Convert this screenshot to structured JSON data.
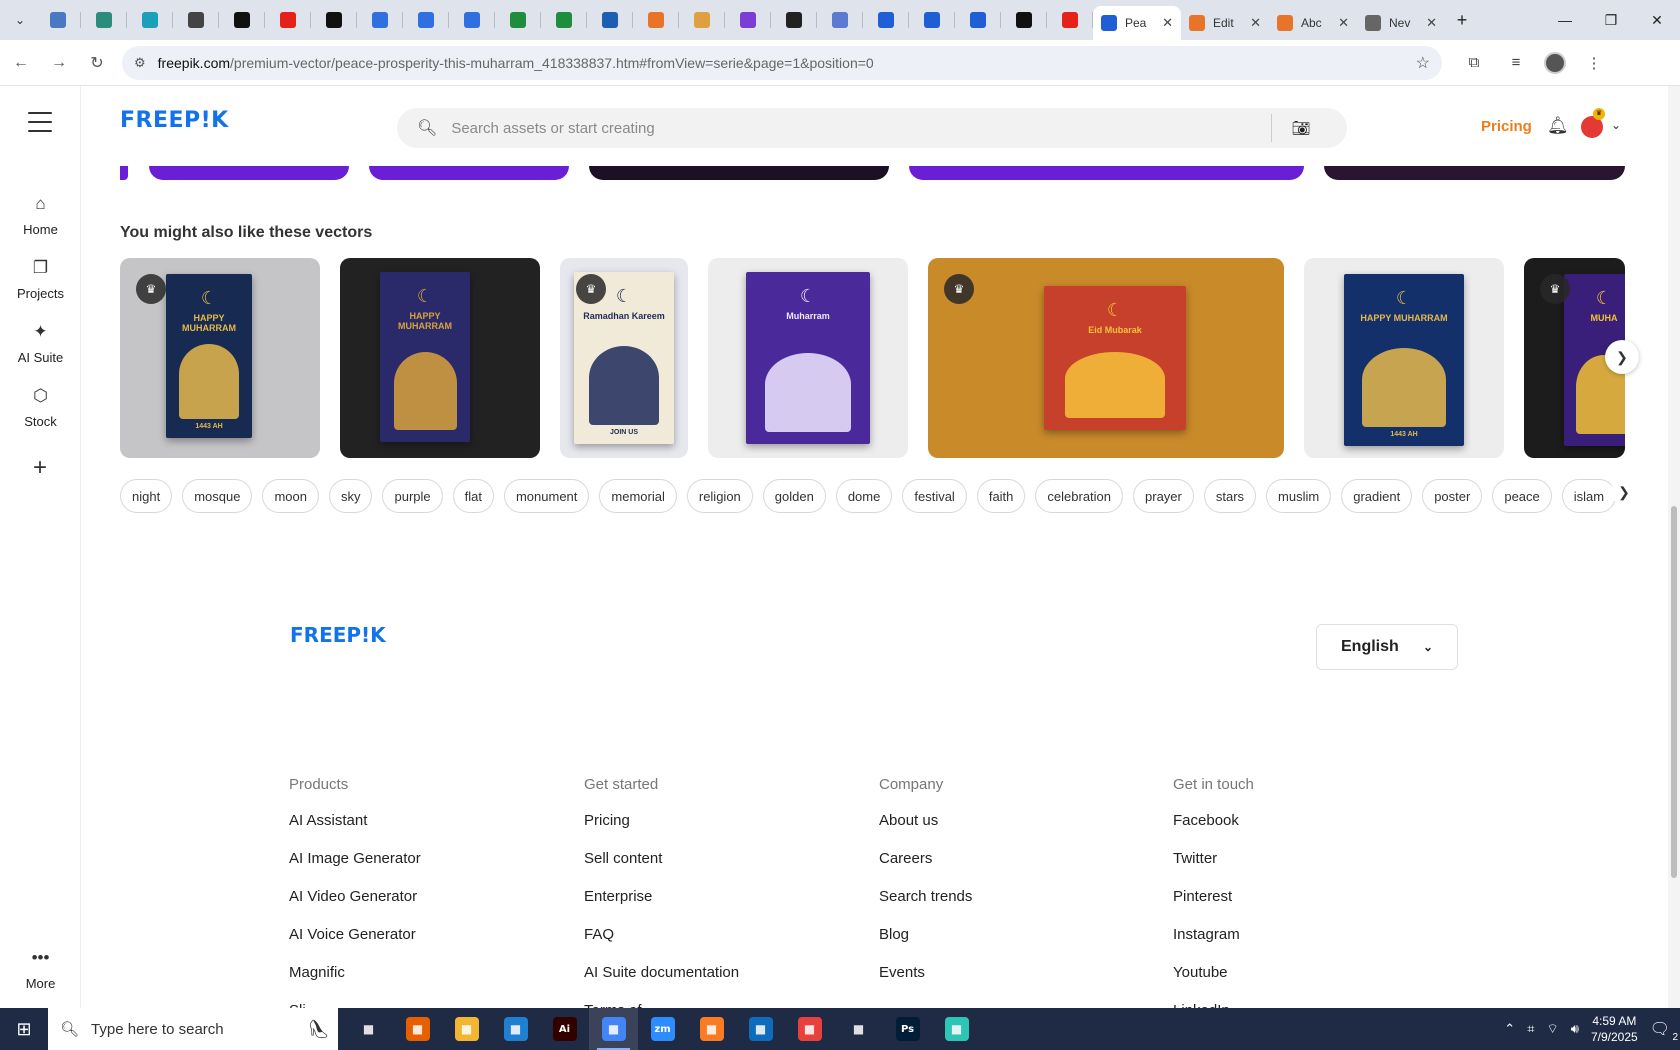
{
  "browser": {
    "pinned_tabs": [
      {
        "icon": "globe-icon",
        "color": "#4a78c2"
      },
      {
        "icon": "vpn-icon",
        "color": "#2a8c7a"
      },
      {
        "icon": "arrow-app-icon",
        "color": "#1aa0b8"
      },
      {
        "icon": "speaker-icon",
        "color": "#444444"
      },
      {
        "icon": "threads-icon",
        "color": "#111111"
      },
      {
        "icon": "youtube-icon",
        "color": "#e62117"
      },
      {
        "icon": "bolt-icon",
        "color": "#111111"
      },
      {
        "icon": "docs-icon",
        "color": "#2f6fe0"
      },
      {
        "icon": "docs-icon",
        "color": "#2f6fe0"
      },
      {
        "icon": "docs-icon",
        "color": "#2f6fe0"
      },
      {
        "icon": "sheets-icon",
        "color": "#1e8e3e"
      },
      {
        "icon": "sheets-icon",
        "color": "#1e8e3e"
      },
      {
        "icon": "word-icon",
        "color": "#1a5fb4"
      },
      {
        "icon": "tool-icon",
        "color": "#e8742a"
      },
      {
        "icon": "star-app-icon",
        "color": "#e0a040"
      },
      {
        "icon": "code-icon",
        "color": "#7a3dd6"
      },
      {
        "icon": "ai-icon",
        "color": "#222222"
      },
      {
        "icon": "grid-icon",
        "color": "#5a7bd0"
      },
      {
        "icon": "freepik-icon",
        "color": "#1f5fd6"
      },
      {
        "icon": "freepik-icon",
        "color": "#1f5fd6"
      },
      {
        "icon": "freepik-icon",
        "color": "#1f5fd6"
      },
      {
        "icon": "m-icon",
        "color": "#111111"
      },
      {
        "icon": "youtube-icon",
        "color": "#e62117"
      }
    ],
    "tabs": [
      {
        "title": "Pea",
        "active": true,
        "icon": "freepik-icon",
        "color": "#1f5fd6"
      },
      {
        "title": "Edit",
        "active": false,
        "icon": "tool-icon",
        "color": "#e8742a"
      },
      {
        "title": "Abc",
        "active": false,
        "icon": "tool-icon",
        "color": "#e8742a"
      },
      {
        "title": "Nev",
        "active": false,
        "icon": "chrome-icon",
        "color": "#666666"
      }
    ],
    "url_host": "freepik.com",
    "url_path": "/premium-vector/peace-prosperity-this-muharram_418338837.htm#fromView=serie&page=1&position=0"
  },
  "leftnav": {
    "items": [
      {
        "label": "Home",
        "icon": "home-icon"
      },
      {
        "label": "Projects",
        "icon": "projects-icon"
      },
      {
        "label": "AI Suite",
        "icon": "sparkle-icon"
      },
      {
        "label": "Stock",
        "icon": "stock-icon"
      }
    ],
    "more_label": "More"
  },
  "header": {
    "logo": "FREEP!K",
    "search_placeholder": "Search assets or start creating",
    "pricing": "Pricing"
  },
  "section": {
    "title": "You might also like these vectors",
    "cards": [
      {
        "bg": "#c5c5c8",
        "poster_bg": "#172a52",
        "accent": "#e5b84b",
        "text": "HAPPY MUHARRAM",
        "sub": "1443 AH",
        "premium": true
      },
      {
        "bg": "#222222",
        "poster_bg": "#2a2a6a",
        "accent": "#d9a23a",
        "text": "HAPPY MUHARRAM",
        "sub": "",
        "premium": false
      },
      {
        "bg": "#e6e8ee",
        "poster_bg": "#f2ead8",
        "accent": "#1d2a5a",
        "text": "Ramadhan Kareem",
        "sub": "JOIN US",
        "premium": true
      },
      {
        "bg": "#ededed",
        "poster_bg": "#4a2a9a",
        "accent": "#f0e6ff",
        "text": "Muharram",
        "sub": "",
        "premium": false
      },
      {
        "bg": "#c98a2a",
        "poster_bg": "#c6402c",
        "accent": "#f6c23a",
        "text": "Eid Mubarak",
        "sub": "",
        "premium": true
      },
      {
        "bg": "#ededed",
        "poster_bg": "#14306a",
        "accent": "#e5b84b",
        "text": "HAPPY MUHARRAM",
        "sub": "1443 AH",
        "premium": false
      },
      {
        "bg": "#1c1c1c",
        "poster_bg": "#3a1f7a",
        "accent": "#f1c232",
        "text": "MUHA",
        "sub": "",
        "premium": true
      }
    ],
    "tags": [
      "night",
      "mosque",
      "moon",
      "sky",
      "purple",
      "flat",
      "monument",
      "memorial",
      "religion",
      "golden",
      "dome",
      "festival",
      "faith",
      "celebration",
      "prayer",
      "stars",
      "muslim",
      "gradient",
      "poster",
      "peace",
      "islam",
      "m"
    ]
  },
  "footer": {
    "logo": "FREEP!K",
    "language": "English",
    "columns": [
      {
        "heading": "Products",
        "links": [
          "AI Assistant",
          "AI Image Generator",
          "AI Video Generator",
          "AI Voice Generator",
          "Magnific",
          "Sli"
        ]
      },
      {
        "heading": "Get started",
        "links": [
          "Pricing",
          "Sell content",
          "Enterprise",
          "FAQ",
          "AI Suite documentation",
          "Terms of"
        ]
      },
      {
        "heading": "Company",
        "links": [
          "About us",
          "Careers",
          "Search trends",
          "Blog",
          "Events"
        ]
      },
      {
        "heading": "Get in touch",
        "links": [
          "Facebook",
          "Twitter",
          "Pinterest",
          "Instagram",
          "Youtube",
          "LinkedIn"
        ]
      }
    ]
  },
  "taskbar": {
    "search_placeholder": "Type here to search",
    "apps": [
      {
        "icon": "task-view-icon",
        "color": "#1f2a44",
        "label": ""
      },
      {
        "icon": "firefox-icon",
        "color": "#e66000",
        "label": ""
      },
      {
        "icon": "file-explorer-icon",
        "color": "#f2b632",
        "label": ""
      },
      {
        "icon": "vscode-icon",
        "color": "#1f7fd1",
        "label": ""
      },
      {
        "icon": "illustrator-icon",
        "color": "#330000",
        "label": "Ai"
      },
      {
        "icon": "chrome-icon",
        "color": "#4285f4",
        "label": "",
        "active": true
      },
      {
        "icon": "zoom-icon",
        "color": "#2d8cff",
        "label": "zm"
      },
      {
        "icon": "xampp-icon",
        "color": "#fb7a24",
        "label": ""
      },
      {
        "icon": "outlook-icon",
        "color": "#0f6cbd",
        "label": ""
      },
      {
        "icon": "creative-cloud-icon",
        "color": "#e8403c",
        "label": ""
      },
      {
        "icon": "pen-icon",
        "color": "#1f2a44",
        "label": ""
      },
      {
        "icon": "photoshop-icon",
        "color": "#001e36",
        "label": "Ps"
      },
      {
        "icon": "app-icon",
        "color": "#2ec4b6",
        "label": ""
      }
    ],
    "time": "4:59 AM",
    "date": "7/9/2025",
    "notification_count": "2"
  }
}
